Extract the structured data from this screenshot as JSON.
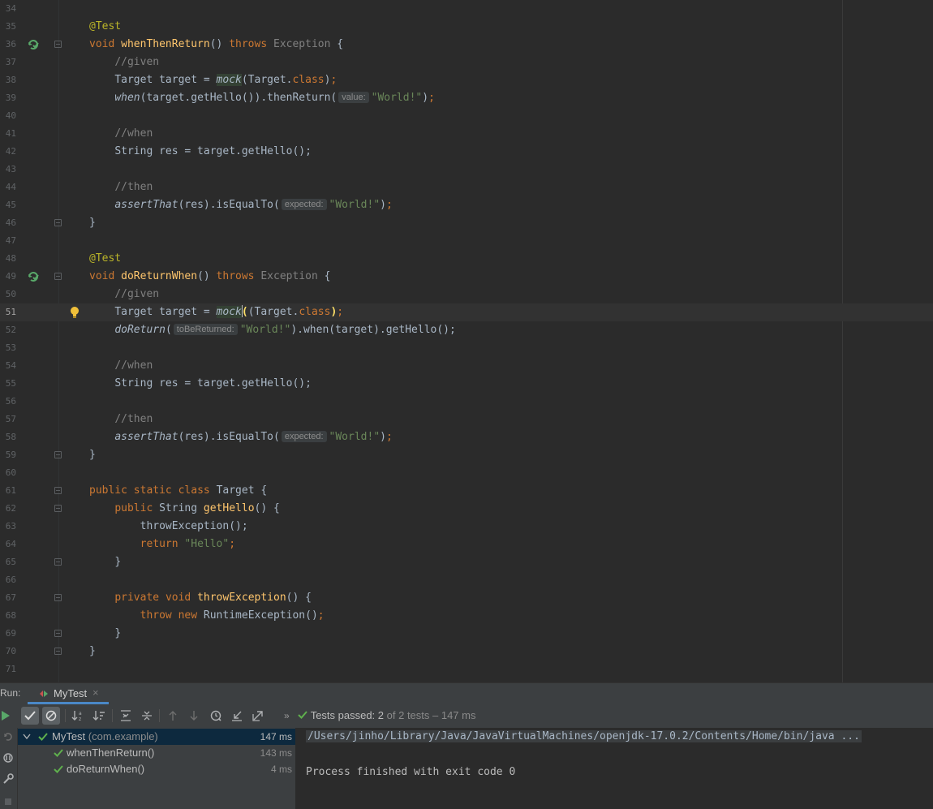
{
  "editor": {
    "lines": [
      {
        "n": "34"
      },
      {
        "n": "35"
      },
      {
        "n": "36"
      },
      {
        "n": "37"
      },
      {
        "n": "38"
      },
      {
        "n": "39"
      },
      {
        "n": "40"
      },
      {
        "n": "41"
      },
      {
        "n": "42"
      },
      {
        "n": "43"
      },
      {
        "n": "44"
      },
      {
        "n": "45"
      },
      {
        "n": "46"
      },
      {
        "n": "47"
      },
      {
        "n": "48"
      },
      {
        "n": "49"
      },
      {
        "n": "50"
      },
      {
        "n": "51"
      },
      {
        "n": "52"
      },
      {
        "n": "53"
      },
      {
        "n": "54"
      },
      {
        "n": "55"
      },
      {
        "n": "56"
      },
      {
        "n": "57"
      },
      {
        "n": "58"
      },
      {
        "n": "59"
      },
      {
        "n": "60"
      },
      {
        "n": "61"
      },
      {
        "n": "62"
      },
      {
        "n": "63"
      },
      {
        "n": "64"
      },
      {
        "n": "65"
      },
      {
        "n": "66"
      },
      {
        "n": "67"
      },
      {
        "n": "68"
      },
      {
        "n": "69"
      },
      {
        "n": "70"
      },
      {
        "n": "71"
      }
    ],
    "tok": {
      "at_test": "@Test",
      "void": "void ",
      "when_then_return_name": "whenThenReturn",
      "do_return_when_name": "doReturnWhen",
      "parens_open_sig": "() ",
      "throws": "throws ",
      "exception": "Exception",
      "brace_open": " {",
      "brace_close": "}",
      "comment_given": "//given",
      "comment_when": "//when",
      "comment_then": "//then",
      "target_decl": "Target target = ",
      "mock": "mock",
      "target_class_open": "(Target.",
      "class_kw": "class",
      "close_semi": ");",
      "close_paren": ")",
      "semi": ";",
      "when_fn": "when",
      "when_args": "(target.getHello()).thenReturn(",
      "hint_value": "value:",
      "str_world": "\"World!\"",
      "string_res": "String res = target.getHello();",
      "assert_that": "assertThat",
      "assert_args": "(res).isEqualTo(",
      "hint_expected": "expected:",
      "do_return": "doReturn",
      "open_paren": "(",
      "hint_to_be_returned": "toBeReturned:",
      "do_return_rest": ").when(target).getHello();",
      "public": "public ",
      "static": "static ",
      "class_sp": "class ",
      "target_name": "Target {",
      "string_sp": "String ",
      "get_hello": "getHello",
      "sig_open": "() {",
      "throw_exception_call": "throwException();",
      "return_kw": "return ",
      "str_hello": "\"Hello\"",
      "private": "private ",
      "throw_exception_name": "throwException",
      "throw_kw": "throw ",
      "new_kw": "new ",
      "runtime_exc": "RuntimeException()"
    }
  },
  "run": {
    "label": "Run:",
    "tab_title": "MyTest",
    "tab_close": "×",
    "toolbar_more": "»",
    "status_prefix": "Tests passed: ",
    "status_count": "2",
    "status_of": " of 2 tests – 147 ms",
    "tree": {
      "root_label": "MyTest",
      "root_pkg": " (com.example)",
      "root_duration": "147 ms",
      "items": [
        {
          "label": "whenThenReturn()",
          "duration": "143 ms"
        },
        {
          "label": "doReturnWhen()",
          "duration": "4 ms"
        }
      ]
    },
    "console": {
      "command": "/Users/jinho/Library/Java/JavaVirtualMachines/openjdk-17.0.2/Contents/Home/bin/java ...",
      "finished": "Process finished with exit code 0"
    }
  },
  "colors": {
    "editor_bg": "#2b2b2b",
    "keyword": "#cc7832",
    "annotation": "#bbb529",
    "function": "#ffc66d",
    "string": "#6a8759",
    "comment": "#808080",
    "pass_green": "#5fb04d",
    "selection": "#0d293e"
  }
}
